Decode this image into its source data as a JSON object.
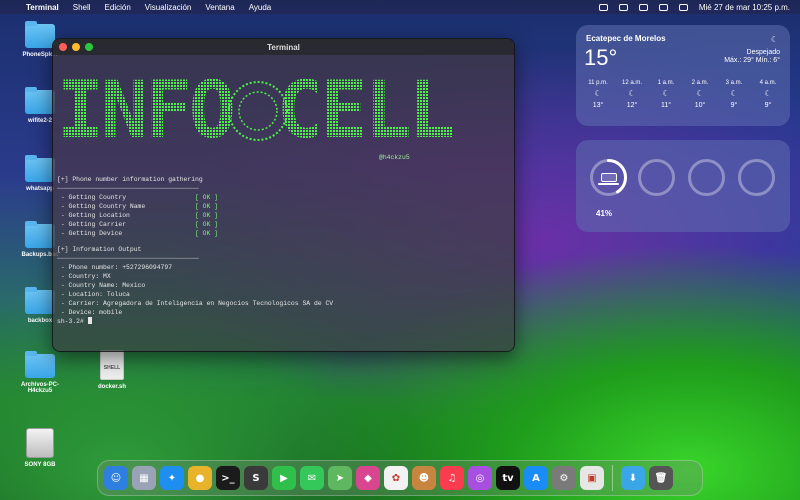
{
  "menubar": {
    "apple_icon": "",
    "app_name": "Terminal",
    "menus": [
      "Shell",
      "Edición",
      "Visualización",
      "Ventana",
      "Ayuda"
    ],
    "date_time": "Mié 27 de mar  10:25 p.m."
  },
  "desktop": {
    "items": [
      {
        "label": "PhoneSploit",
        "type": "folder"
      },
      {
        "label": "wifite2-2",
        "type": "folder"
      },
      {
        "label": "whatsapp",
        "type": "folder"
      },
      {
        "label": "Backups.bac",
        "type": "folder"
      },
      {
        "label": "backbox",
        "type": "folder"
      },
      {
        "label": "Archivos-PC-H4ckzu5",
        "type": "folder"
      },
      {
        "label": "docker.sh",
        "type": "file",
        "badge": "SHELL"
      },
      {
        "label": "SONY 8GB",
        "type": "drive"
      }
    ]
  },
  "terminal": {
    "title": "Terminal",
    "banner_text": "INFO CELL",
    "handle": "@h4ckzu5",
    "section1_header": "[+] Phone number information gathering",
    "separator": "─────────────────────────────────────",
    "checks": [
      {
        "label": " - Getting Country",
        "status": "[ OK ]"
      },
      {
        "label": " - Getting Country Name",
        "status": "[ OK ]"
      },
      {
        "label": " - Getting Location",
        "status": "[ OK ]"
      },
      {
        "label": " - Getting Carrier",
        "status": "[ OK ]"
      },
      {
        "label": " - Getting Device",
        "status": "[ OK ]"
      }
    ],
    "section2_header": "[+] Information Output",
    "outputs": [
      " - Phone number: +527296094797",
      " - Country: MX",
      " - Country Name: Mexico",
      " - Location: Toluca",
      " - Carrier: Agregadora de Inteligencia en Negocios Tecnologicos SA de CV",
      " - Device: mobile"
    ],
    "prompt": "sh-3.2# "
  },
  "weather": {
    "city": "Ecatepec de Morelos",
    "temp": "15°",
    "condition": "Despejado",
    "range": "Máx.: 29° Mín.: 6°",
    "hours": [
      {
        "time": "11 p.m.",
        "temp": "13°"
      },
      {
        "time": "12 a.m.",
        "temp": "12°"
      },
      {
        "time": "1 a.m.",
        "temp": "11°"
      },
      {
        "time": "2 a.m.",
        "temp": "10°"
      },
      {
        "time": "3 a.m.",
        "temp": "9°"
      },
      {
        "time": "4 a.m.",
        "temp": "9°"
      }
    ]
  },
  "battery": {
    "percent_label": "41%",
    "level": 0.41
  },
  "dock": {
    "apps": [
      {
        "name": "finder",
        "color": "#2f7fe0",
        "glyph": "☺"
      },
      {
        "name": "launchpad",
        "color": "#9aa3b5",
        "glyph": "▦"
      },
      {
        "name": "safari",
        "color": "#1e8ef0",
        "glyph": "✦"
      },
      {
        "name": "chrome",
        "color": "#e8b32b",
        "glyph": "●"
      },
      {
        "name": "terminal",
        "color": "#1b1b1b",
        "glyph": ">_"
      },
      {
        "name": "sublime",
        "color": "#3a3a3a",
        "glyph": "S"
      },
      {
        "name": "facetime",
        "color": "#2fbf4a",
        "glyph": "▶"
      },
      {
        "name": "messages",
        "color": "#34c759",
        "glyph": "✉"
      },
      {
        "name": "maps",
        "color": "#5fb760",
        "glyph": "➤"
      },
      {
        "name": "shortcuts",
        "color": "#d9468f",
        "glyph": "◆"
      },
      {
        "name": "photos",
        "color": "#f2f2f2",
        "glyph": "✿"
      },
      {
        "name": "contacts",
        "color": "#c78540",
        "glyph": "☻"
      },
      {
        "name": "music",
        "color": "#fa3c4f",
        "glyph": "♫"
      },
      {
        "name": "podcasts",
        "color": "#a64fe0",
        "glyph": "◎"
      },
      {
        "name": "tv",
        "color": "#111111",
        "glyph": "tv"
      },
      {
        "name": "app-store",
        "color": "#1a8cf5",
        "glyph": "A"
      },
      {
        "name": "system-settings",
        "color": "#7a7a7a",
        "glyph": "⚙"
      },
      {
        "name": "preview",
        "color": "#e6e6e6",
        "glyph": "▣"
      },
      {
        "name": "downloads",
        "color": "#3aa6e8",
        "glyph": "⬇"
      },
      {
        "name": "trash",
        "color": "#555555",
        "glyph": "🗑"
      }
    ]
  }
}
